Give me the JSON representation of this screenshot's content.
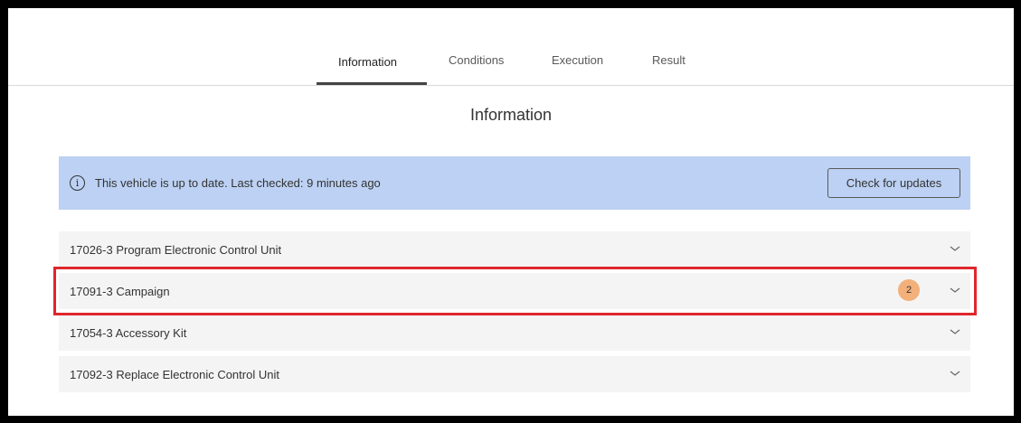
{
  "tabs": [
    {
      "label": "Information",
      "active": true
    },
    {
      "label": "Conditions",
      "active": false
    },
    {
      "label": "Execution",
      "active": false
    },
    {
      "label": "Result",
      "active": false
    }
  ],
  "page_title": "Information",
  "banner": {
    "icon": "info-icon",
    "icon_glyph": "i",
    "text": "This vehicle is up to date. Last checked: 9 minutes ago",
    "button_label": "Check for updates",
    "background": "#bcd1f3"
  },
  "items": [
    {
      "label": "17026-3 Program Electronic Control Unit",
      "badge": null
    },
    {
      "label": "17091-3 Campaign",
      "badge": "2",
      "highlighted": true
    },
    {
      "label": "17054-3 Accessory Kit",
      "badge": null
    },
    {
      "label": "17092-3 Replace Electronic Control Unit",
      "badge": null
    }
  ],
  "colors": {
    "badge": "#f3b07a",
    "highlight_border": "#e0262d",
    "item_background": "#f4f4f4"
  }
}
